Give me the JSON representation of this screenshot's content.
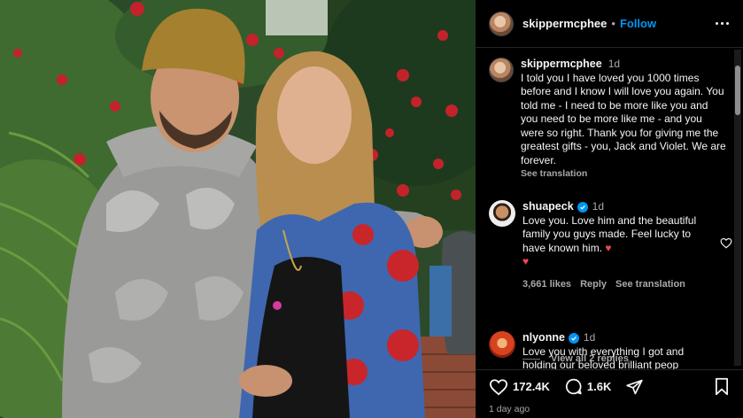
{
  "colors": {
    "accent": "#0095f6",
    "panel_bg": "#000000",
    "muted": "#a8a8a8",
    "like_red": "#ed4956"
  },
  "post_header": {
    "username": "skippermcphee",
    "separator": "•",
    "follow_label": "Follow",
    "more_icon": "more-horizontal-icon"
  },
  "caption": {
    "username": "skippermcphee",
    "time": "1d",
    "text": "I told you I have loved you 1000 times before and I know I will love you again. You told me - I need to be more like you and you need to be more like me - and you were so right.  Thank you for giving me the greatest gifts -  you, Jack and Violet. We are forever.",
    "see_translation": "See translation"
  },
  "comments": [
    {
      "username": "shuapeck",
      "verified": true,
      "time": "1d",
      "text": "Love you. Love him and the beautiful family you guys made. Feel lucky to have known him.",
      "text_heart": "♥",
      "emoji_line": "♥",
      "likes": "3,661 likes",
      "reply_label": "Reply",
      "see_translation": "See translation",
      "view_replies": "View all 2 replies"
    },
    {
      "username": "nlyonne",
      "verified": true,
      "time": "1d",
      "text": "Love you with everything I got and holding our beloved brilliant peop"
    }
  ],
  "actions": {
    "likes_count": "172.4K",
    "comments_count": "1.6K",
    "time_ago": "1 day ago"
  }
}
